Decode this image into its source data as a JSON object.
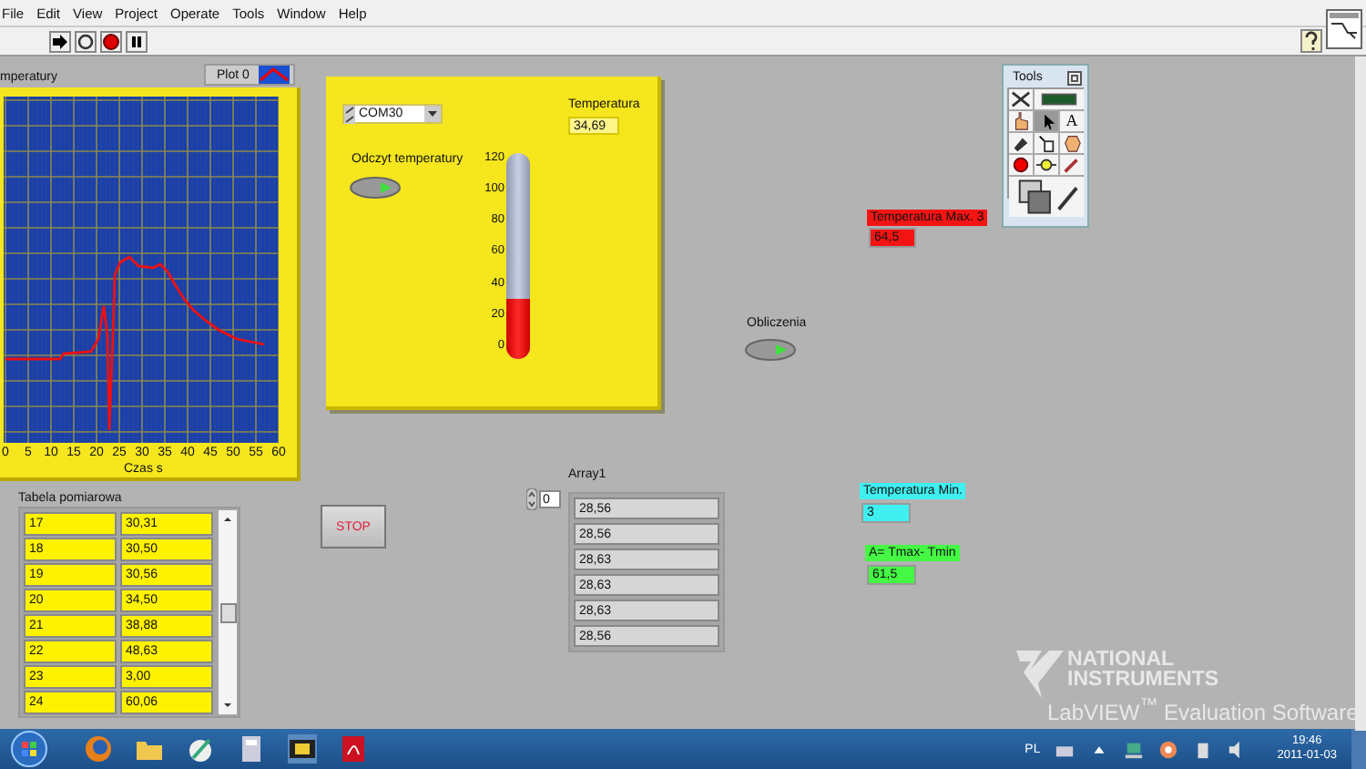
{
  "menu_bar": [
    "File",
    "Edit",
    "View",
    "Project",
    "Operate",
    "Tools",
    "Window",
    "Help"
  ],
  "graph": {
    "title": "mperatury",
    "legend": "Plot 0",
    "x_tick_labels": [
      "0",
      "5",
      "10",
      "15",
      "20",
      "25",
      "30",
      "35",
      "40",
      "45",
      "50",
      "55",
      "60"
    ],
    "x_label": "Czas s"
  },
  "temperature_panel": {
    "port": "COM30",
    "reading_label": "Temperatura",
    "reading": "34,69",
    "toggle_label": "Odczyt temperatury",
    "toggle_on": true,
    "scale": [
      "120",
      "100",
      "80",
      "60",
      "40",
      "20",
      "0"
    ],
    "level": 0.29
  },
  "tools_palette": {
    "title": "Tools",
    "text_tool": "A"
  },
  "max": {
    "label": "Temperatura Max. 3",
    "value": "64,5"
  },
  "calc": {
    "label": "Obliczenia",
    "on": true
  },
  "array": {
    "label": "Array1",
    "index": "0",
    "values": [
      "28,56",
      "28,56",
      "28,63",
      "28,63",
      "28,63",
      "28,56"
    ]
  },
  "stop": "STOP",
  "table": {
    "label": "Tabela pomiarowa",
    "rows": [
      [
        "17",
        "30,31"
      ],
      [
        "18",
        "30,50"
      ],
      [
        "19",
        "30,56"
      ],
      [
        "20",
        "34,50"
      ],
      [
        "21",
        "38,88"
      ],
      [
        "22",
        "48,63"
      ],
      [
        "23",
        "3,00"
      ],
      [
        "24",
        "60,06"
      ]
    ]
  },
  "min": {
    "label": "Temperatura Min.",
    "value": "3"
  },
  "range": {
    "label": "A= Tmax- Tmin",
    "value": "61,5"
  },
  "watermark": {
    "line_1": "NATIONAL",
    "line_2": "INSTRUMENTS",
    "line_3": "LabVIEW$^{™}$ Evaluation Software"
  },
  "taskbar": {
    "language": "PL",
    "time": "19:46",
    "date": "2011-01-03"
  }
}
